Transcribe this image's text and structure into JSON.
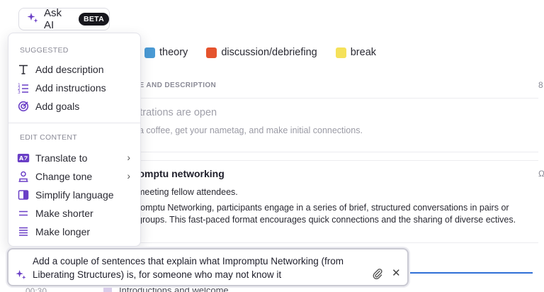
{
  "ask_ai": {
    "label": "Ask AI",
    "badge": "BETA"
  },
  "legend": [
    {
      "label": "theory",
      "color": "#4a9ad4"
    },
    {
      "label": "discussion/debriefing",
      "color": "#e5532d"
    },
    {
      "label": "break",
      "color": "#f5e15a"
    }
  ],
  "table": {
    "column_header": "LE AND DESCRIPTION",
    "rows": [
      {
        "title": "strations are open",
        "description": "a coffee, get your nametag, and make initial connections."
      },
      {
        "title": "romptu networking",
        "line1": "meeting fellow attendees.",
        "line2": "romptu Networking, participants engage in a series of brief, structured conversations in pairs or groups. This fast-paced format encourages quick connections and the sharing of diverse ectives."
      }
    ],
    "next_time": "00:30",
    "next_title": "Introductions and welcome"
  },
  "menu": {
    "suggested_label": "SUGGESTED",
    "suggested": [
      {
        "label": "Add description",
        "icon": "text-icon"
      },
      {
        "label": "Add instructions",
        "icon": "numbered-list-icon"
      },
      {
        "label": "Add goals",
        "icon": "target-icon"
      }
    ],
    "edit_label": "EDIT CONTENT",
    "edit": [
      {
        "label": "Translate to",
        "icon": "translate-icon",
        "submenu": true
      },
      {
        "label": "Change tone",
        "icon": "person-icon",
        "submenu": true
      },
      {
        "label": "Simplify language",
        "icon": "book-icon",
        "submenu": false
      },
      {
        "label": "Make shorter",
        "icon": "short-lines-icon",
        "submenu": false
      },
      {
        "label": "Make longer",
        "icon": "long-lines-icon",
        "submenu": false
      }
    ]
  },
  "prompt": {
    "value": "Add a couple of sentences that explain what Impromptu Networking (from Liberating Structures) is, for someone who may not know it"
  },
  "colors": {
    "accent": "#6a3fc6",
    "link_blue": "#2f6fd6"
  }
}
